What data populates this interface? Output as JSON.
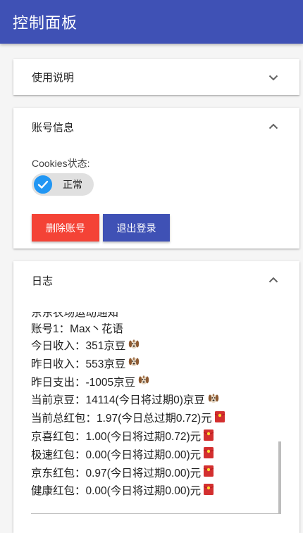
{
  "appbar": {
    "title": "控制面板"
  },
  "panels": {
    "usage": {
      "title": "使用说明"
    },
    "account": {
      "title": "账号信息",
      "cookie_label": "Cookies状态:",
      "cookie_status": "正常",
      "delete_label": "删除账号",
      "logout_label": "退出登录"
    },
    "log": {
      "title": "日志",
      "lines": [
        "东东农场运动通知",
        "账号1：Max丶花语",
        "今日收入：351京豆",
        "昨日收入：553京豆",
        "昨日支出：-1005京豆",
        "当前京豆：14114(今日将过期0)京豆",
        "当前总红包：1.97(今日总过期0.72)元",
        "京喜红包：1.00(今日将过期0.72)元",
        "极速红包：0.00(今日将过期0.00)元",
        "京东红包：0.97(今日将过期0.00)元",
        "健康红包：0.00(今日将过期0.00)元"
      ]
    }
  },
  "colors": {
    "primary": "#3f51b5",
    "danger": "#f44336",
    "accent": "#2196f3"
  },
  "icons": {
    "bean": "dog-icon",
    "red_packet": "red-packet-icon"
  }
}
